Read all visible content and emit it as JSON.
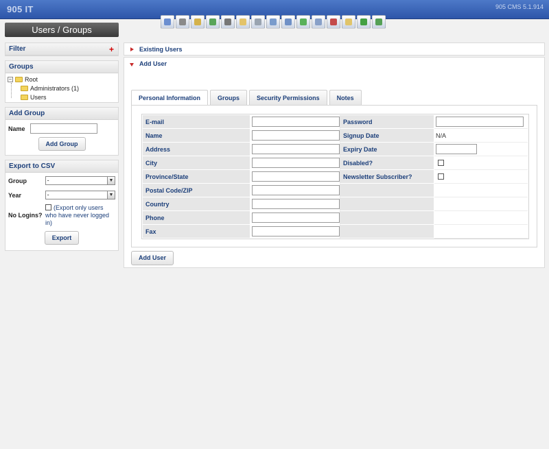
{
  "header": {
    "brand": "905 IT",
    "version": "905 CMS 5.1.914"
  },
  "toolbar_icons": [
    {
      "name": "chart-icon",
      "color": "#6c8fd0"
    },
    {
      "name": "users-icon",
      "color": "#8a8a8a"
    },
    {
      "name": "edit-icon",
      "color": "#d4b24c"
    },
    {
      "name": "image-add-icon",
      "color": "#5aa55a"
    },
    {
      "name": "font-icon",
      "color": "#777777"
    },
    {
      "name": "mail-icon",
      "color": "#e3c36a"
    },
    {
      "name": "database-icon",
      "color": "#9aa4b0"
    },
    {
      "name": "list-icon",
      "color": "#7a9ccc"
    },
    {
      "name": "contact-icon",
      "color": "#6f90c6"
    },
    {
      "name": "approve-icon",
      "color": "#5ab15a"
    },
    {
      "name": "form-icon",
      "color": "#88a0c8"
    },
    {
      "name": "tools-icon",
      "color": "#c44b4b"
    },
    {
      "name": "note-icon",
      "color": "#e0c46a"
    },
    {
      "name": "phone-icon",
      "color": "#43a043"
    },
    {
      "name": "logout-icon",
      "color": "#55a055"
    }
  ],
  "sidebar": {
    "title": "Users / Groups",
    "filter": {
      "heading": "Filter",
      "add_symbol": "+"
    },
    "groups": {
      "heading": "Groups",
      "tree": {
        "root": "Root",
        "children": [
          "Administrators (1)",
          "Users"
        ]
      }
    },
    "add_group": {
      "heading": "Add Group",
      "name_label": "Name",
      "name_value": "",
      "button": "Add Group"
    },
    "export": {
      "heading": "Export to CSV",
      "group_label": "Group",
      "group_value": "-",
      "year_label": "Year",
      "year_value": "-",
      "no_logins_label": "No Logins?",
      "no_logins_hint": "(Export only users who have never logged in)",
      "button": "Export"
    }
  },
  "main": {
    "existing_users": "Existing Users",
    "add_user": "Add User",
    "tabs": [
      "Personal Information",
      "Groups",
      "Security Permissions",
      "Notes"
    ],
    "active_tab": "Personal Information",
    "left_fields": [
      "E-mail",
      "Name",
      "Address",
      "City",
      "Province/State",
      "Postal Code/ZIP",
      "Country",
      "Phone",
      "Fax"
    ],
    "right_fields": {
      "password": "Password",
      "signup_date": "Signup Date",
      "signup_value": "N/A",
      "expiry_date": "Expiry Date",
      "disabled": "Disabled?",
      "newsletter": "Newsletter Subscriber?"
    },
    "submit_button": "Add User"
  }
}
